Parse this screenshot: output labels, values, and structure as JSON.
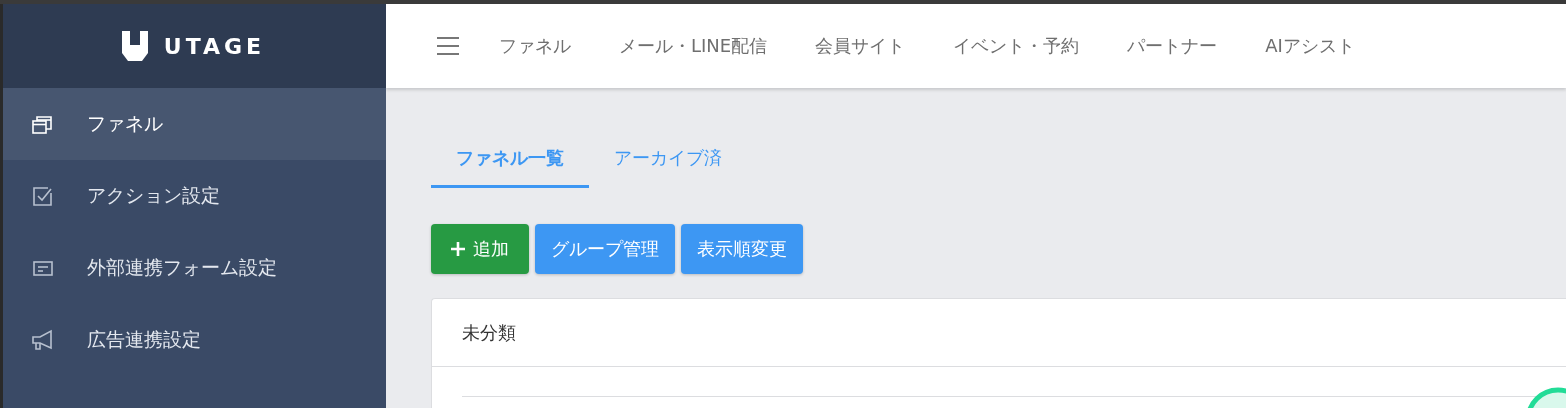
{
  "logo": {
    "text": "UTAGE"
  },
  "sidebar": {
    "items": [
      {
        "label": "ファネル",
        "selected": true
      },
      {
        "label": "アクション設定",
        "selected": false
      },
      {
        "label": "外部連携フォーム設定",
        "selected": false
      },
      {
        "label": "広告連携設定",
        "selected": false
      }
    ]
  },
  "top_nav": {
    "items": [
      "ファネル",
      "メール・LINE配信",
      "会員サイト",
      "イベント・予約",
      "パートナー",
      "AIアシスト"
    ]
  },
  "tabs": [
    {
      "label": "ファネル一覧",
      "selected": true
    },
    {
      "label": "アーカイブ済",
      "selected": false
    }
  ],
  "buttons": [
    {
      "label": "追加",
      "kind": "add"
    },
    {
      "label": "グループ管理",
      "kind": "primary"
    },
    {
      "label": "表示順変更",
      "kind": "primary"
    }
  ],
  "card": {
    "title": "未分類"
  }
}
